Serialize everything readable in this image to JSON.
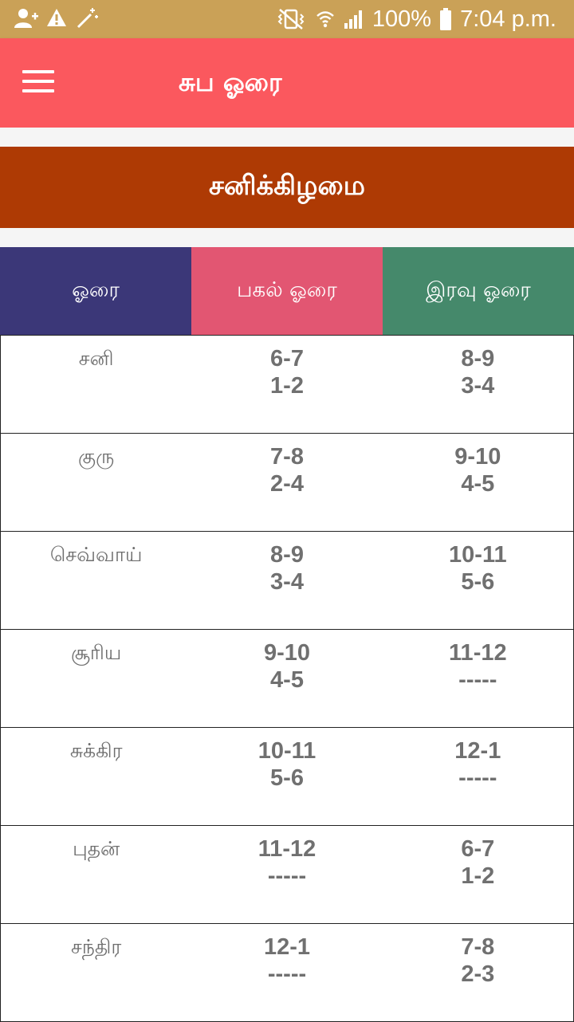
{
  "status_bar": {
    "battery": "100%",
    "time": "7:04 p.m."
  },
  "app_bar": {
    "title": "சுப ஓரை"
  },
  "day": "சனிக்கிழமை",
  "table": {
    "headers": [
      "ஓரை",
      "பகல் ஓரை",
      "இரவு ஓரை"
    ],
    "rows": [
      {
        "planet": "சனி",
        "day": [
          "6-7",
          "1-2"
        ],
        "night": [
          "8-9",
          "3-4"
        ]
      },
      {
        "planet": "குரு",
        "day": [
          "7-8",
          "2-4"
        ],
        "night": [
          "9-10",
          "4-5"
        ]
      },
      {
        "planet": "செவ்வாய்",
        "day": [
          "8-9",
          "3-4"
        ],
        "night": [
          "10-11",
          "5-6"
        ]
      },
      {
        "planet": "சூரிய",
        "day": [
          "9-10",
          "4-5"
        ],
        "night": [
          "11-12",
          "-----"
        ]
      },
      {
        "planet": "சுக்கிர",
        "day": [
          "10-11",
          "5-6"
        ],
        "night": [
          "12-1",
          "-----"
        ]
      },
      {
        "planet": "புதன்",
        "day": [
          "11-12",
          "-----"
        ],
        "night": [
          "6-7",
          "1-2"
        ]
      },
      {
        "planet": "சந்திர",
        "day": [
          "12-1",
          "-----"
        ],
        "night": [
          "7-8",
          "2-3"
        ]
      }
    ]
  }
}
